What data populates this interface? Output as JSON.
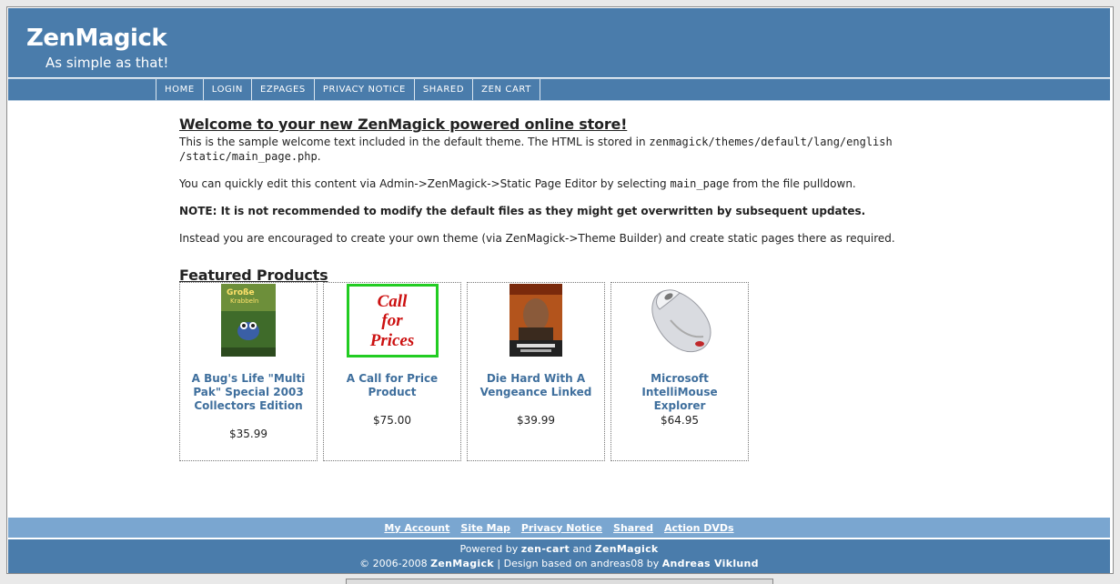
{
  "header": {
    "title": "ZenMagick",
    "tagline": "As simple as that!"
  },
  "nav": {
    "items": [
      "HOME",
      "LOGIN",
      "EZPAGES",
      "PRIVACY NOTICE",
      "SHARED",
      "ZEN CART"
    ]
  },
  "welcome": {
    "title": "Welcome to your new ZenMagick powered online store!",
    "p1_text": "This is the sample welcome text included in the default theme. The HTML is stored in ",
    "p1_code": "zenmagick/themes/default/lang/english",
    "p1_code2": "/static/main_page.php",
    "p1_end": ".",
    "p2_text": "You can quickly edit this content via Admin->ZenMagick->Static Page Editor by selecting ",
    "p2_code": "main_page",
    "p2_end": " from the file pulldown.",
    "note": "NOTE: It is not recommended to modify the default files as they might get overwritten by subsequent updates.",
    "p4": "Instead you are encouraged to create your own theme (via ZenMagick->Theme Builder) and create static pages there as required."
  },
  "featured": {
    "title": "Featured Products",
    "products": [
      {
        "name": "A Bug's Life \"Multi Pak\" Special 2003 Collectors Edition",
        "price": "$35.99",
        "image": "dvd-cover-icon"
      },
      {
        "name": "A Call for Price Product",
        "price": "$75.00",
        "image": "call-for-prices-image",
        "image_text": [
          "Call",
          "for",
          "Prices"
        ]
      },
      {
        "name": "Die Hard With A Vengeance Linked",
        "price": "$39.99",
        "image": "dvd-cover-icon"
      },
      {
        "name": "Microsoft IntelliMouse Explorer",
        "price": "$64.95",
        "image": "mouse-icon"
      }
    ]
  },
  "footer": {
    "links": [
      "My Account",
      "Site Map",
      "Privacy Notice",
      "Shared",
      "Action DVDs"
    ],
    "powered_prefix": "Powered by ",
    "powered_a": "zen-cart",
    "powered_mid": " and ",
    "powered_b": "ZenMagick",
    "copyright_prefix": "© 2006-2008 ",
    "copyright_brand": "ZenMagick",
    "copyright_mid": " | Design based on andreas08 by ",
    "copyright_author": "Andreas Viklund"
  },
  "colors": {
    "header_bg": "#4a7cab",
    "footer_links_bg": "#7aa6d0",
    "link": "#3f6f9d",
    "call_border": "#22cc22",
    "call_text": "#cc1111"
  }
}
